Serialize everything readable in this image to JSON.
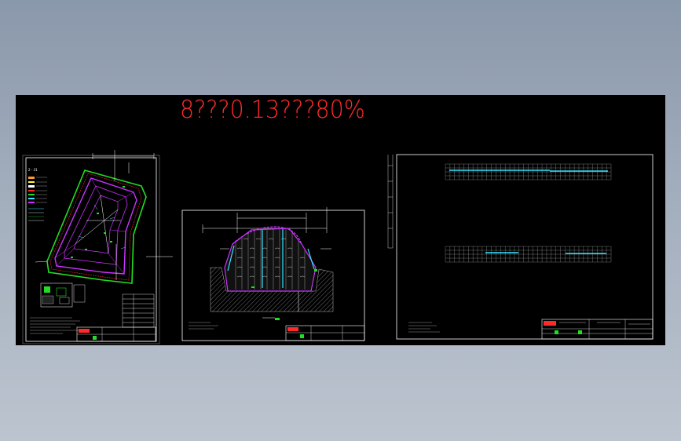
{
  "canvas": {
    "background": "#000000",
    "title_text": "8???0.13???80%",
    "title_color": "#ff2a2a"
  },
  "sheets": [
    {
      "name": "site-plan-sheet",
      "description_label": ""
    },
    {
      "name": "section-sheet",
      "description_label": ""
    },
    {
      "name": "profile-table-sheet",
      "description_label": ""
    }
  ],
  "colors": {
    "frame": "#ffffff",
    "green": "#22dd22",
    "magenta": "#cc33ff",
    "cyan": "#33e6ff",
    "red": "#ff2a2a",
    "yellow": "#ffff33",
    "grey": "#9a9a9a"
  }
}
